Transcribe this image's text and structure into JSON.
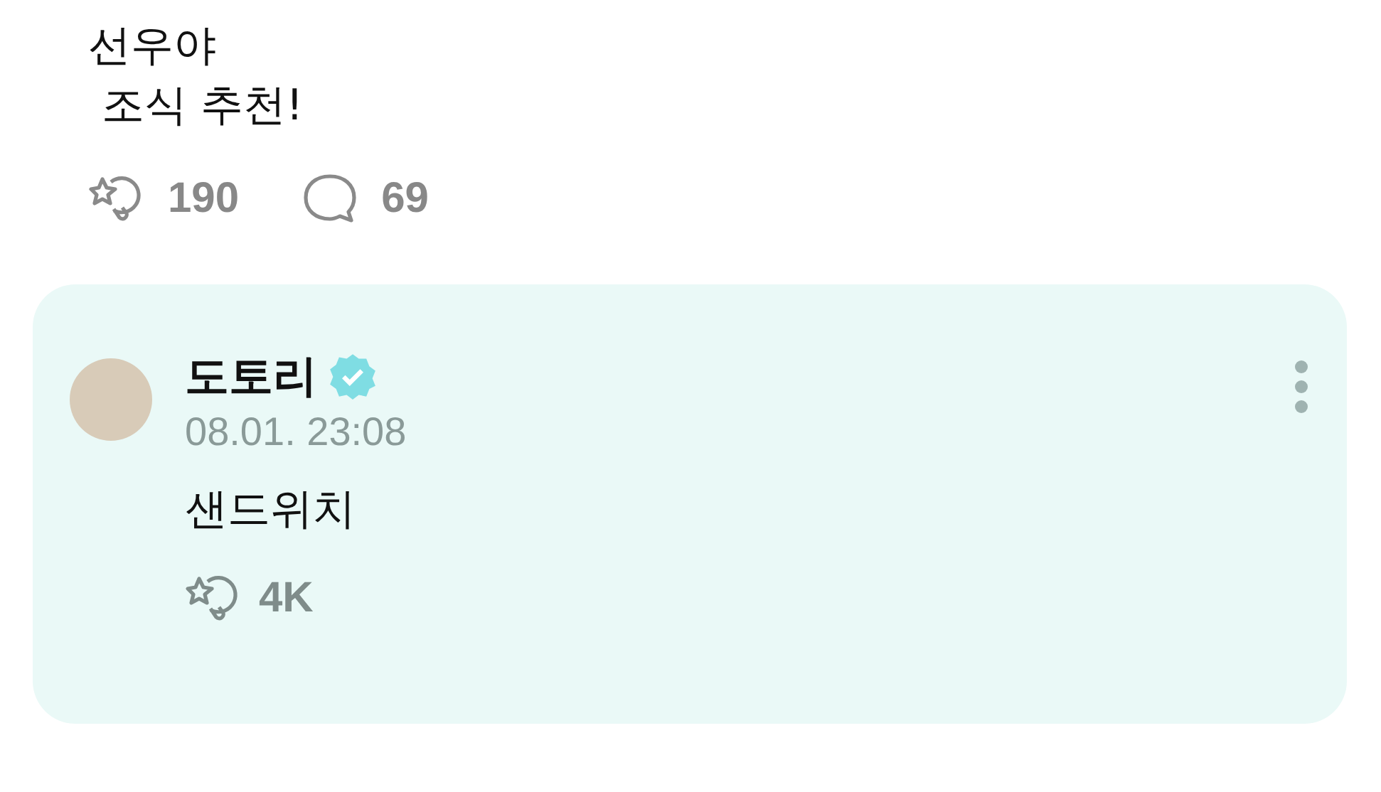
{
  "post": {
    "lines": [
      "선우야",
      " 조식 추천!"
    ],
    "reactions": "190",
    "comments": "69"
  },
  "reply": {
    "name": "도토리",
    "verified": true,
    "time": "08.01. 23:08",
    "text": "샌드위치",
    "reactions": "4K"
  }
}
